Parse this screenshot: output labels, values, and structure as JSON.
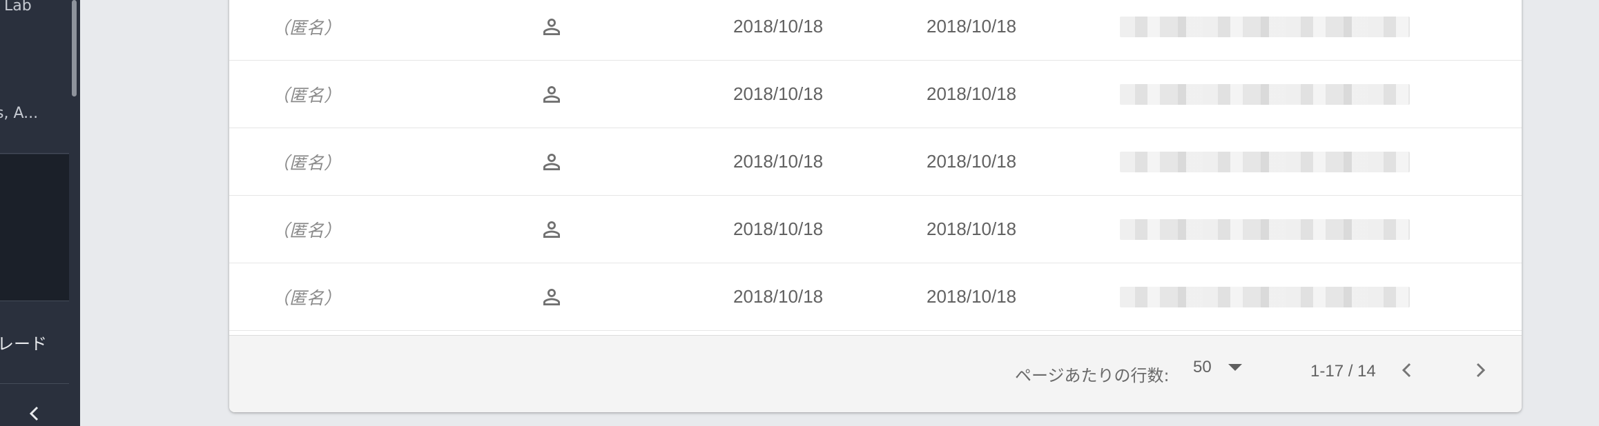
{
  "sidebar": {
    "item_lab": "Lab",
    "item_truncated": "s, A...",
    "upgrade_label": "レード",
    "collapse_icon": "chevron-left-icon"
  },
  "table": {
    "rows": [
      {
        "name": "（匿名）",
        "icon": "person-icon",
        "date1": "2018/10/18",
        "date2": "2018/10/18"
      },
      {
        "name": "（匿名）",
        "icon": "person-icon",
        "date1": "2018/10/18",
        "date2": "2018/10/18"
      },
      {
        "name": "（匿名）",
        "icon": "person-icon",
        "date1": "2018/10/18",
        "date2": "2018/10/18"
      },
      {
        "name": "（匿名）",
        "icon": "person-icon",
        "date1": "2018/10/18",
        "date2": "2018/10/18"
      },
      {
        "name": "（匿名）",
        "icon": "person-icon",
        "date1": "2018/10/18",
        "date2": "2018/10/18"
      }
    ]
  },
  "pagination": {
    "rows_per_page_label": "ページあたりの行数:",
    "rows_per_page_value": "50",
    "range_label": "1-17 / 14"
  },
  "colors": {
    "sidebar_bg": "#2a303d",
    "card_bg": "#ffffff",
    "page_bg": "#e8eaed",
    "footer_bg": "#f4f4f4"
  }
}
